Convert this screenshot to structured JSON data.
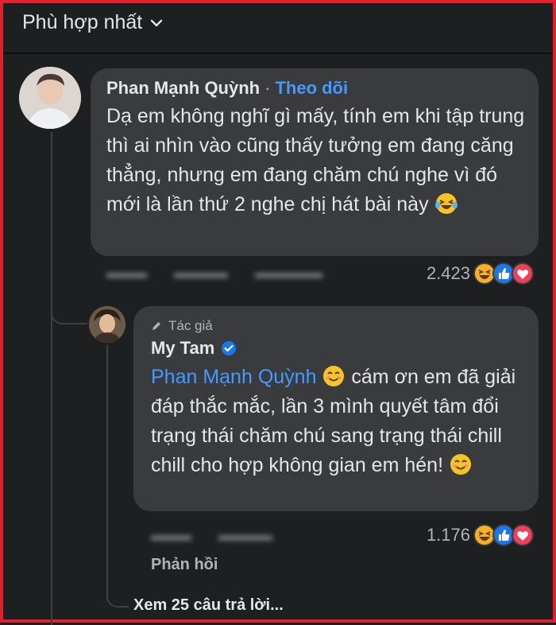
{
  "sort": {
    "label": "Phù hợp nhất",
    "icon": "chevron-down-icon"
  },
  "comment1": {
    "author": "Phan Mạnh Quỳnh",
    "separator": "·",
    "follow_label": "Theo dõi",
    "text": "Dạ em không nghĩ gì mấy, tính em khi tập trung thì ai nhìn vào cũng thấy tưởng em đang căng thẳng, nhưng em đang chăm chú nghe vì đó mới là lần thứ 2 nghe chị hát bài này",
    "trailing_emoji": "laughing-tears-emoji",
    "reaction_count": "2.423"
  },
  "reply1": {
    "author_badge": "Tác giả",
    "author": "My Tam",
    "verified_icon": "verified-badge-icon",
    "mention": "Phan Mạnh Quỳnh",
    "text": "cám ơn em đã giải đáp thắc mắc, lần 3 mình quyết tâm đổi trạng thái chăm chú sang trạng thái chill chill cho hợp không gian em hén!",
    "reaction_count": "1.176",
    "reply_label": "Phản hồi"
  },
  "view_more_label": "Xem 25 câu trả lời...",
  "colors": {
    "background": "#1e1f20",
    "bubble": "#3a3b3c",
    "link": "#4599ff",
    "like": "#1877f2",
    "love": "#f33e58",
    "haha": "#f7b125"
  }
}
